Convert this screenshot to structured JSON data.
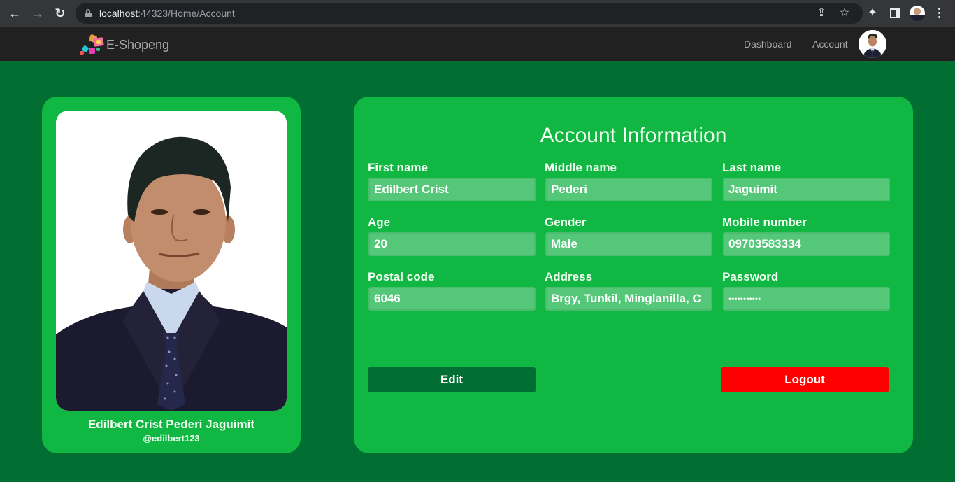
{
  "browser": {
    "url_host": "localhost",
    "url_rest": ":44323/Home/Account",
    "icons": {
      "back": "back-arrow-icon",
      "forward": "forward-arrow-icon",
      "reload": "reload-icon",
      "lock": "lock-icon",
      "share": "share-icon",
      "bookmark": "star-icon",
      "extensions": "puzzle-icon",
      "side_panel": "side-panel-icon",
      "profile": "profile-avatar",
      "menu": "kebab-menu-icon"
    },
    "glyphs": {
      "back": "←",
      "forward": "→",
      "reload": "↻",
      "share": "⇪",
      "bookmark": "☆",
      "extensions": "✦"
    }
  },
  "navbar": {
    "brand": "E-Shopeng",
    "links": [
      {
        "label": "Dashboard"
      },
      {
        "label": "Account"
      }
    ]
  },
  "profile": {
    "full_name": "Edilbert Crist Pederi Jaguimit",
    "username": "@edilbert123"
  },
  "account": {
    "title": "Account Information",
    "fields": [
      {
        "label": "First name",
        "value": "Edilbert Crist"
      },
      {
        "label": "Middle name",
        "value": "Pederi"
      },
      {
        "label": "Last name",
        "value": "Jaguimit"
      },
      {
        "label": "Age",
        "value": "20"
      },
      {
        "label": "Gender",
        "value": "Male"
      },
      {
        "label": "Mobile number",
        "value": "09703583334"
      },
      {
        "label": "Postal code",
        "value": "6046"
      },
      {
        "label": "Address",
        "value": "Brgy, Tunkil, Minglanilla, C"
      },
      {
        "label": "Password",
        "value": "•••••••••••"
      }
    ],
    "buttons": {
      "edit": "Edit",
      "logout": "Logout"
    }
  },
  "colors": {
    "page_bg": "#006f31",
    "card_bg": "#10b843",
    "input_bg": "#55c779",
    "edit_button": "#006f31",
    "logout_button": "#ff0000",
    "navbar_bg": "#212121"
  }
}
